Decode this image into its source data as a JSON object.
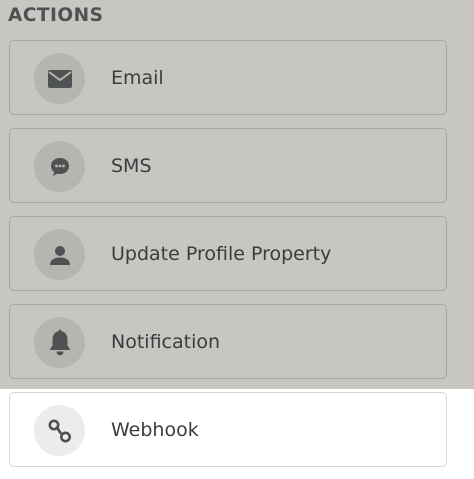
{
  "actions": {
    "title": "ACTIONS",
    "items": [
      {
        "label": "Email",
        "icon": "envelope-icon"
      },
      {
        "label": "SMS",
        "icon": "chat-bubble-icon"
      },
      {
        "label": "Update Profile Property",
        "icon": "person-icon"
      },
      {
        "label": "Notification",
        "icon": "bell-icon"
      },
      {
        "label": "Webhook",
        "icon": "webhook-icon"
      }
    ]
  },
  "colors": {
    "panel_background": "#c7c6c0",
    "selected_card_background": "#ffffff",
    "text": "#3a3d3f",
    "icon": "#4f5253"
  }
}
